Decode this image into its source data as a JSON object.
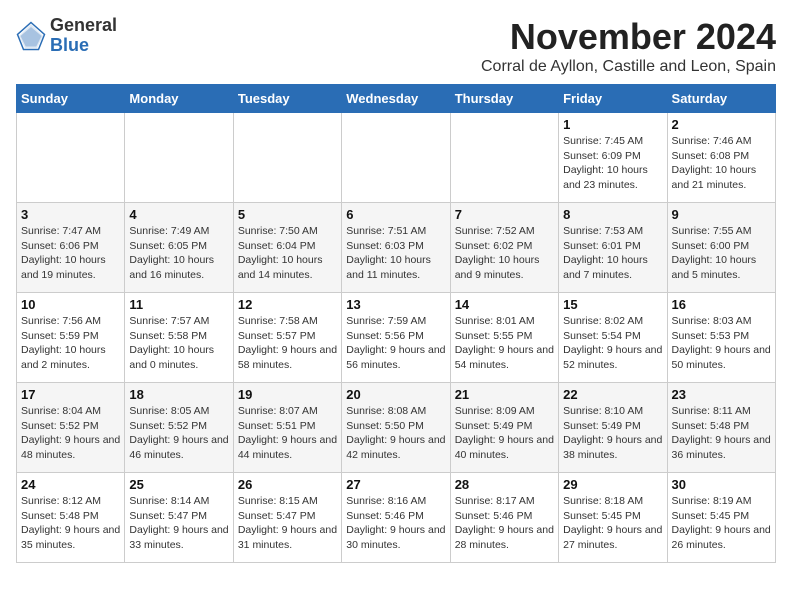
{
  "logo": {
    "general": "General",
    "blue": "Blue"
  },
  "header": {
    "month_year": "November 2024",
    "location": "Corral de Ayllon, Castille and Leon, Spain"
  },
  "days_of_week": [
    "Sunday",
    "Monday",
    "Tuesday",
    "Wednesday",
    "Thursday",
    "Friday",
    "Saturday"
  ],
  "weeks": [
    [
      {
        "day": "",
        "info": ""
      },
      {
        "day": "",
        "info": ""
      },
      {
        "day": "",
        "info": ""
      },
      {
        "day": "",
        "info": ""
      },
      {
        "day": "",
        "info": ""
      },
      {
        "day": "1",
        "info": "Sunrise: 7:45 AM\nSunset: 6:09 PM\nDaylight: 10 hours and 23 minutes."
      },
      {
        "day": "2",
        "info": "Sunrise: 7:46 AM\nSunset: 6:08 PM\nDaylight: 10 hours and 21 minutes."
      }
    ],
    [
      {
        "day": "3",
        "info": "Sunrise: 7:47 AM\nSunset: 6:06 PM\nDaylight: 10 hours and 19 minutes."
      },
      {
        "day": "4",
        "info": "Sunrise: 7:49 AM\nSunset: 6:05 PM\nDaylight: 10 hours and 16 minutes."
      },
      {
        "day": "5",
        "info": "Sunrise: 7:50 AM\nSunset: 6:04 PM\nDaylight: 10 hours and 14 minutes."
      },
      {
        "day": "6",
        "info": "Sunrise: 7:51 AM\nSunset: 6:03 PM\nDaylight: 10 hours and 11 minutes."
      },
      {
        "day": "7",
        "info": "Sunrise: 7:52 AM\nSunset: 6:02 PM\nDaylight: 10 hours and 9 minutes."
      },
      {
        "day": "8",
        "info": "Sunrise: 7:53 AM\nSunset: 6:01 PM\nDaylight: 10 hours and 7 minutes."
      },
      {
        "day": "9",
        "info": "Sunrise: 7:55 AM\nSunset: 6:00 PM\nDaylight: 10 hours and 5 minutes."
      }
    ],
    [
      {
        "day": "10",
        "info": "Sunrise: 7:56 AM\nSunset: 5:59 PM\nDaylight: 10 hours and 2 minutes."
      },
      {
        "day": "11",
        "info": "Sunrise: 7:57 AM\nSunset: 5:58 PM\nDaylight: 10 hours and 0 minutes."
      },
      {
        "day": "12",
        "info": "Sunrise: 7:58 AM\nSunset: 5:57 PM\nDaylight: 9 hours and 58 minutes."
      },
      {
        "day": "13",
        "info": "Sunrise: 7:59 AM\nSunset: 5:56 PM\nDaylight: 9 hours and 56 minutes."
      },
      {
        "day": "14",
        "info": "Sunrise: 8:01 AM\nSunset: 5:55 PM\nDaylight: 9 hours and 54 minutes."
      },
      {
        "day": "15",
        "info": "Sunrise: 8:02 AM\nSunset: 5:54 PM\nDaylight: 9 hours and 52 minutes."
      },
      {
        "day": "16",
        "info": "Sunrise: 8:03 AM\nSunset: 5:53 PM\nDaylight: 9 hours and 50 minutes."
      }
    ],
    [
      {
        "day": "17",
        "info": "Sunrise: 8:04 AM\nSunset: 5:52 PM\nDaylight: 9 hours and 48 minutes."
      },
      {
        "day": "18",
        "info": "Sunrise: 8:05 AM\nSunset: 5:52 PM\nDaylight: 9 hours and 46 minutes."
      },
      {
        "day": "19",
        "info": "Sunrise: 8:07 AM\nSunset: 5:51 PM\nDaylight: 9 hours and 44 minutes."
      },
      {
        "day": "20",
        "info": "Sunrise: 8:08 AM\nSunset: 5:50 PM\nDaylight: 9 hours and 42 minutes."
      },
      {
        "day": "21",
        "info": "Sunrise: 8:09 AM\nSunset: 5:49 PM\nDaylight: 9 hours and 40 minutes."
      },
      {
        "day": "22",
        "info": "Sunrise: 8:10 AM\nSunset: 5:49 PM\nDaylight: 9 hours and 38 minutes."
      },
      {
        "day": "23",
        "info": "Sunrise: 8:11 AM\nSunset: 5:48 PM\nDaylight: 9 hours and 36 minutes."
      }
    ],
    [
      {
        "day": "24",
        "info": "Sunrise: 8:12 AM\nSunset: 5:48 PM\nDaylight: 9 hours and 35 minutes."
      },
      {
        "day": "25",
        "info": "Sunrise: 8:14 AM\nSunset: 5:47 PM\nDaylight: 9 hours and 33 minutes."
      },
      {
        "day": "26",
        "info": "Sunrise: 8:15 AM\nSunset: 5:47 PM\nDaylight: 9 hours and 31 minutes."
      },
      {
        "day": "27",
        "info": "Sunrise: 8:16 AM\nSunset: 5:46 PM\nDaylight: 9 hours and 30 minutes."
      },
      {
        "day": "28",
        "info": "Sunrise: 8:17 AM\nSunset: 5:46 PM\nDaylight: 9 hours and 28 minutes."
      },
      {
        "day": "29",
        "info": "Sunrise: 8:18 AM\nSunset: 5:45 PM\nDaylight: 9 hours and 27 minutes."
      },
      {
        "day": "30",
        "info": "Sunrise: 8:19 AM\nSunset: 5:45 PM\nDaylight: 9 hours and 26 minutes."
      }
    ]
  ]
}
